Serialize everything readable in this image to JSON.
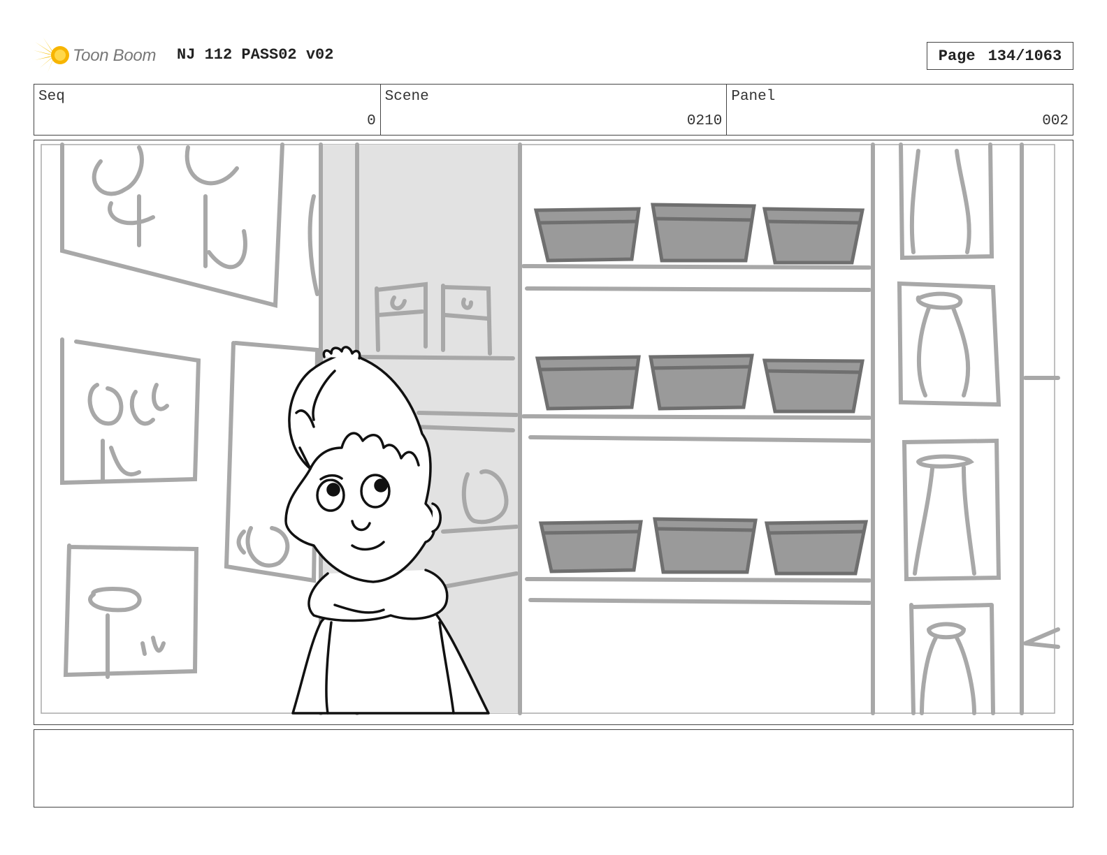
{
  "header": {
    "logo_text": "Toon Boom",
    "project_title": "NJ 112 PASS02 v02",
    "page_label": "Page",
    "page_number": "134/1063"
  },
  "info": {
    "seq_label": "Seq",
    "seq_value": "0",
    "scene_label": "Scene",
    "scene_value": "0210",
    "panel_label": "Panel",
    "panel_value": "002"
  },
  "notes": {
    "text": ""
  },
  "colors": {
    "logo_yellow": "#f5c518",
    "sketch_gray": "#a8a8a8",
    "bowl_fill": "#9a9a9a",
    "pillar_fill": "#e2e2e2",
    "line_dark": "#111111"
  }
}
